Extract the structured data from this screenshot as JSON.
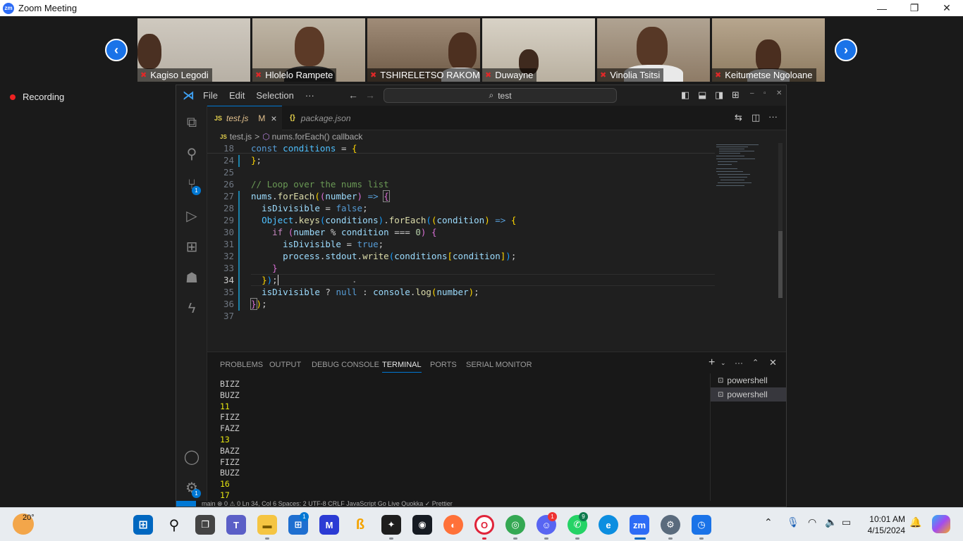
{
  "zoom": {
    "title": "Zoom Meeting",
    "logo": "zm",
    "recording": "Recording",
    "participants": [
      {
        "name": "Kagiso Legodi"
      },
      {
        "name": "Hlolelo Rampete"
      },
      {
        "name": "TSHIRELETSO RAKOMA"
      },
      {
        "name": "Duwayne"
      },
      {
        "name": "Vinolia Tsitsi"
      },
      {
        "name": "Keitumetse Ngoloane"
      }
    ]
  },
  "vscode": {
    "menu": [
      "File",
      "Edit",
      "Selection",
      "···"
    ],
    "search": "test",
    "tabs": [
      {
        "icon": "JS",
        "label": "test.js",
        "status": "M",
        "close": "×"
      },
      {
        "icon": "{}",
        "label": "package.json"
      }
    ],
    "breadcrumb": {
      "file": "test.js",
      "sep": ">",
      "symbol": "nums.forEach() callback"
    },
    "activity_badges": {
      "scm": "1",
      "settings": "1"
    },
    "line_numbers": [
      "18",
      "24",
      "25",
      "26",
      "27",
      "28",
      "29",
      "30",
      "31",
      "32",
      "33",
      "34",
      "35",
      "36",
      "37"
    ],
    "panel_tabs": [
      "PROBLEMS",
      "OUTPUT",
      "DEBUG CONSOLE",
      "TERMINAL",
      "PORTS",
      "SERIAL MONITOR"
    ],
    "active_panel_tab": "TERMINAL",
    "terminal_lines": [
      "BIZZ",
      "BUZZ",
      "11",
      "FIZZ",
      "FAZZ",
      "13",
      "BAZZ",
      "FIZZ",
      "BUZZ",
      "16",
      "17"
    ],
    "terminals": [
      "powershell",
      "powershell"
    ],
    "status": "main   ⊗ 0 ⚠ 0   Ln 34, Col 6   Spaces: 2   UTF-8   CRLF   JavaScript   Go Live   Quokka   ✓ Prettier"
  },
  "taskbar": {
    "weather": "20°",
    "time": "10:01 AM",
    "date": "4/15/2024",
    "badges": {
      "store": "1",
      "discord": "1",
      "whatsapp": "9"
    }
  }
}
